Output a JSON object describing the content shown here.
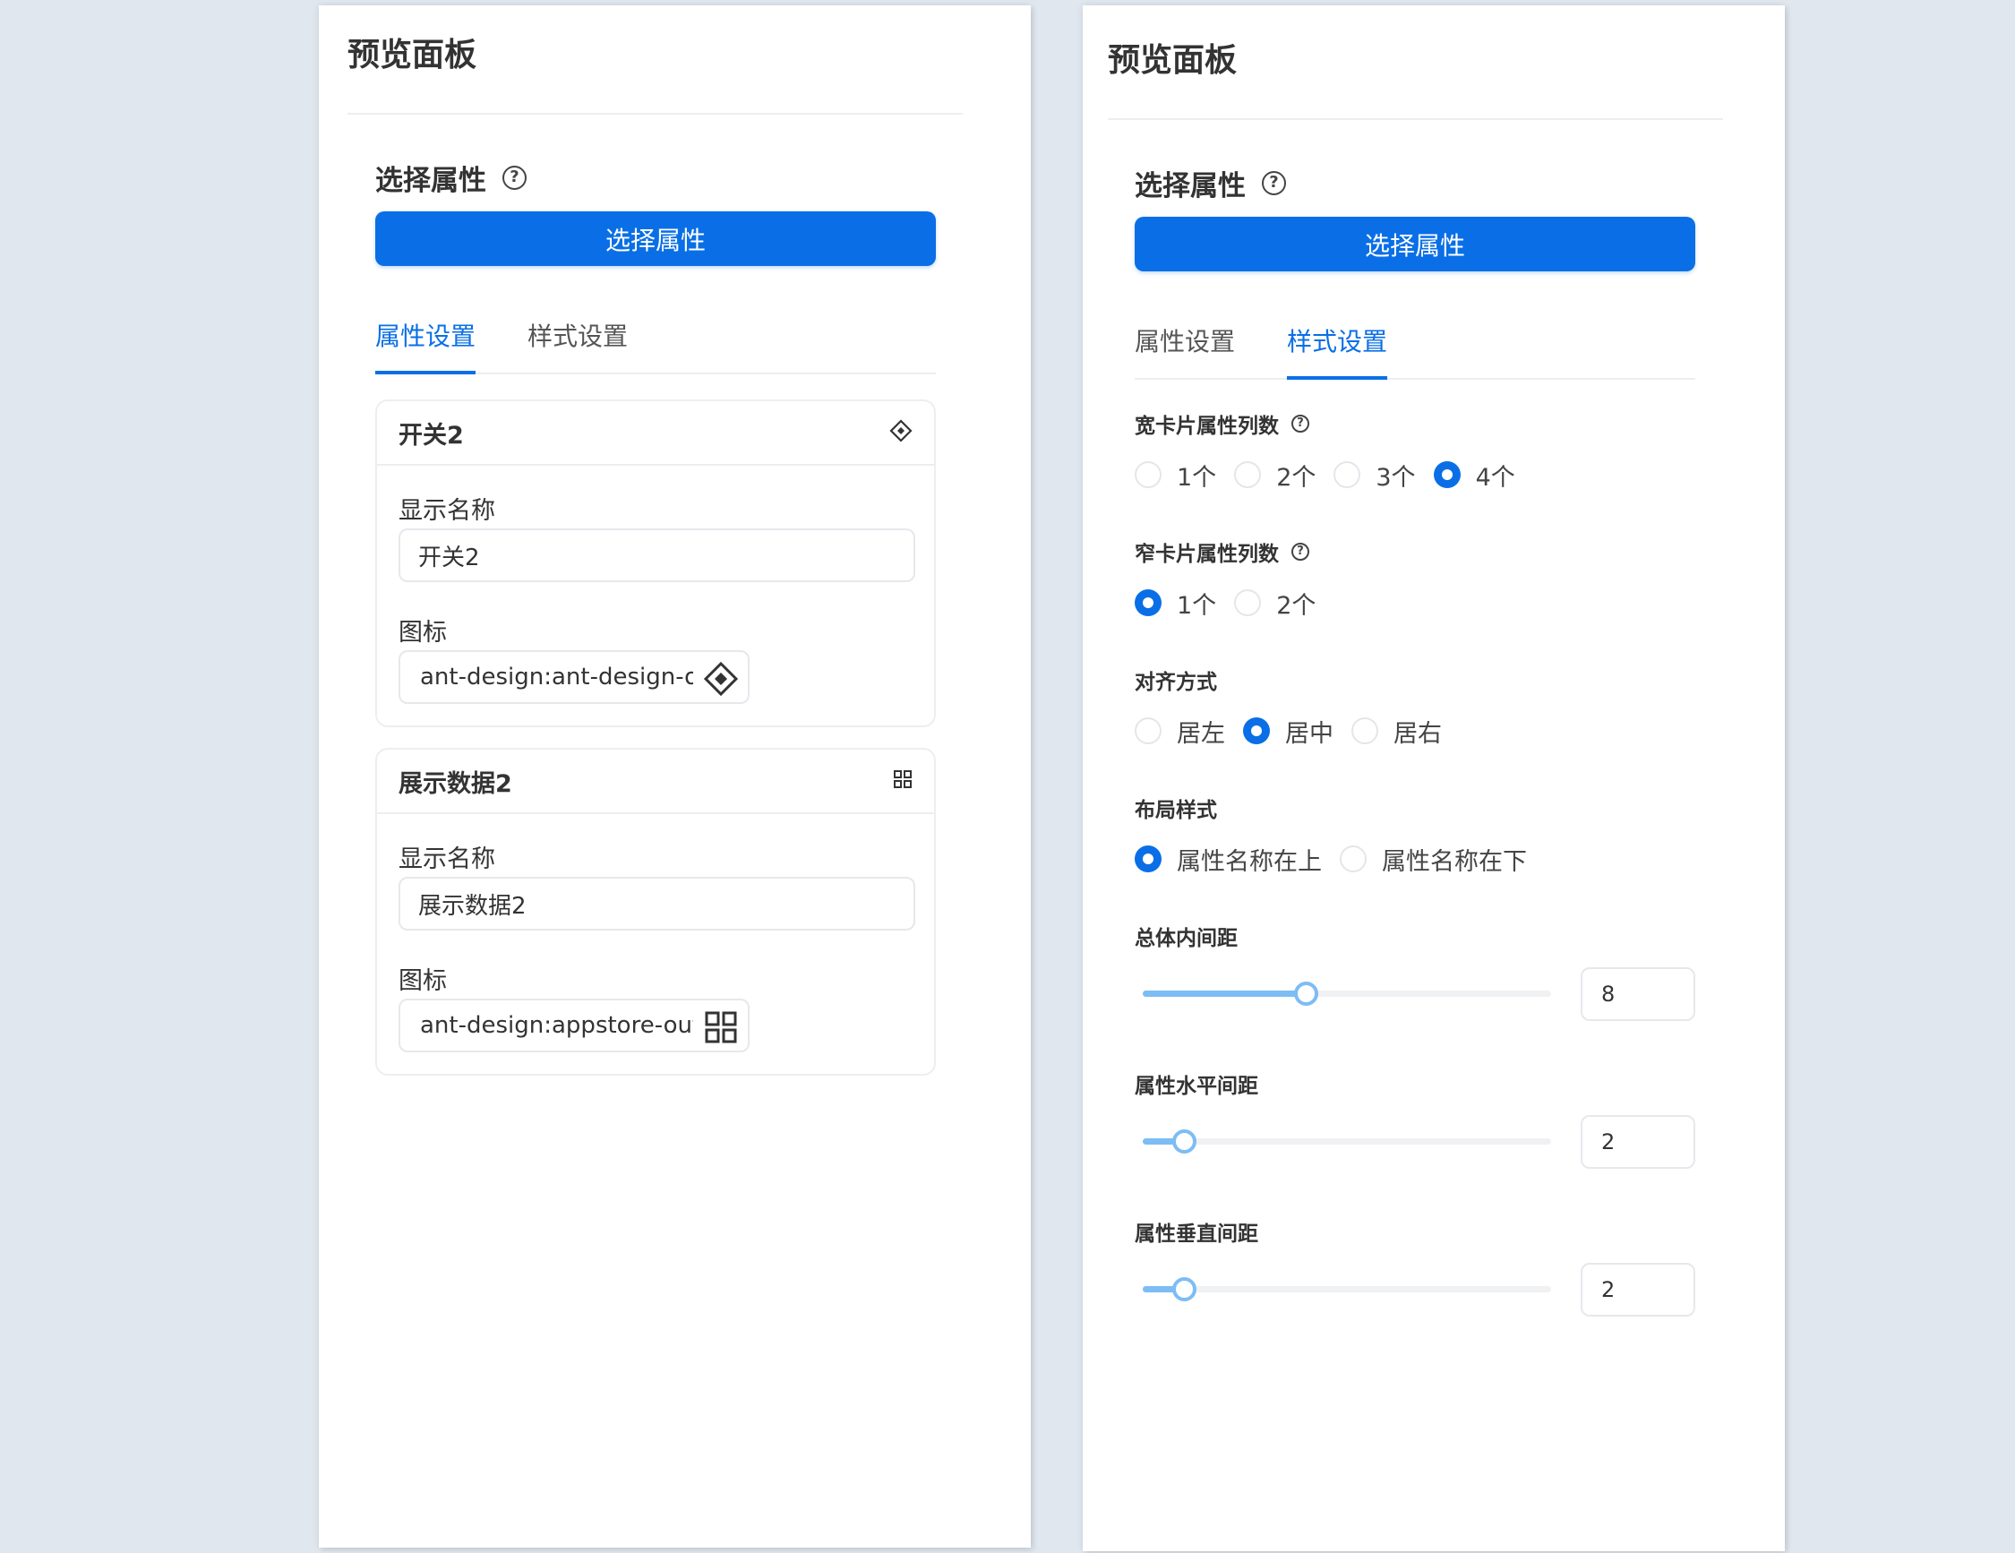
{
  "left_panel": {
    "title": "预览面板",
    "section_title": "选择属性",
    "select_button": "选择属性",
    "tabs": [
      {
        "label": "属性设置",
        "active": true
      },
      {
        "label": "样式设置",
        "active": false
      }
    ],
    "cards": [
      {
        "title": "开关2",
        "header_icon": "ant-design-outlined-icon",
        "name_label": "显示名称",
        "name_value": "开关2",
        "icon_label": "图标",
        "icon_value": "ant-design:ant-design-ou",
        "icon_glyph": "ant-design-outlined-icon"
      },
      {
        "title": "展示数据2",
        "header_icon": "appstore-icon",
        "name_label": "显示名称",
        "name_value": "展示数据2",
        "icon_label": "图标",
        "icon_value": "ant-design:appstore-outli",
        "icon_glyph": "appstore-icon"
      }
    ]
  },
  "right_panel": {
    "title": "预览面板",
    "section_title": "选择属性",
    "select_button": "选择属性",
    "tabs": [
      {
        "label": "属性设置",
        "active": false
      },
      {
        "label": "样式设置",
        "active": true
      }
    ],
    "wide_columns": {
      "label": "宽卡片属性列数",
      "options": [
        "1个",
        "2个",
        "3个",
        "4个"
      ],
      "selected": "4个"
    },
    "narrow_columns": {
      "label": "窄卡片属性列数",
      "options": [
        "1个",
        "2个"
      ],
      "selected": "1个"
    },
    "alignment": {
      "label": "对齐方式",
      "options": [
        "居左",
        "居中",
        "居右"
      ],
      "selected": "居中"
    },
    "layout": {
      "label": "布局样式",
      "options": [
        "属性名称在上",
        "属性名称在下"
      ],
      "selected": "属性名称在上"
    },
    "padding": {
      "label": "总体内间距",
      "value": "8",
      "fraction": 0.4
    },
    "horizontal_gap": {
      "label": "属性水平间距",
      "value": "2",
      "fraction": 0.1
    },
    "vertical_gap": {
      "label": "属性垂直间距",
      "value": "2",
      "fraction": 0.1
    }
  },
  "colors": {
    "primary": "#0a6fe6",
    "slider": "#7cbdf4",
    "background": "#e1e7ef"
  }
}
